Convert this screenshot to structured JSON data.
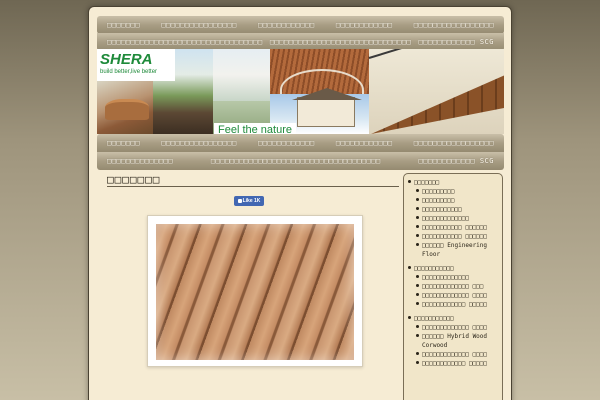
{
  "nav": {
    "row1": [
      "□□□□□□□",
      "□□□□□□□□□□□□□□□□",
      "□□□□□□□□□□□□",
      "□□□□□□□□□□□□",
      "□□□□□□□□□□□□□□□□□"
    ],
    "row2": [
      "□□□□□□□□□□□□□□□□□□□□□□□□□□□□□□□□□",
      "□□□□□□□□□□□□□□□□□□□□□□□□□□□□□□",
      "□□□□□□□□□□□□ SCG"
    ],
    "row3": [
      "□□□□□□□",
      "□□□□□□□□□□□□□□□□",
      "□□□□□□□□□□□□",
      "□□□□□□□□□□□□",
      "□□□□□□□□□□□□□□□□□"
    ],
    "row4": [
      "□□□□□□□□□□□□□□",
      "□□□□□□□□□□□□□□□□□□□□□□□□□□□□□□□□□□□□",
      "□□□□□□□□□□□□ SCG"
    ]
  },
  "banner": {
    "logo": "SHERA",
    "logo_tagline": "build better,live better",
    "tagline": "Feel the nature"
  },
  "main": {
    "title": "□□□□□□□",
    "fb_like": "Like 1K",
    "caption": "□□□□□□□ □□□□□□□□□□□□□□□□□□□□□□□□□□□□ □□□□□□□□□□□□□□□□"
  },
  "sidebar": {
    "groups": [
      {
        "title": "□□□□□□□",
        "items": [
          "□□□□□□□□□",
          "□□□□□□□□□",
          "□□□□□□□□□□□",
          "□□□□□□□□□□□□□",
          "□□□□□□□□□□□ □□□□□□",
          "□□□□□□□□□□□ □□□□□□",
          "□□□□□□ Engineering Floor"
        ]
      },
      {
        "title": "□□□□□□□□□□□",
        "items": [
          "□□□□□□□□□□□□□",
          "□□□□□□□□□□□□□ □□□",
          "□□□□□□□□□□□□□ □□□□",
          "□□□□□□□□□□□□ □□□□□"
        ]
      },
      {
        "title": "□□□□□□□□□□□",
        "items": [
          "□□□□□□□□□□□□□ □□□□",
          "□□□□□□ Hybrid Wood Corwood",
          "□□□□□□□□□□□□□ □□□□",
          "□□□□□□□□□□□□ □□□□□"
        ]
      }
    ]
  }
}
